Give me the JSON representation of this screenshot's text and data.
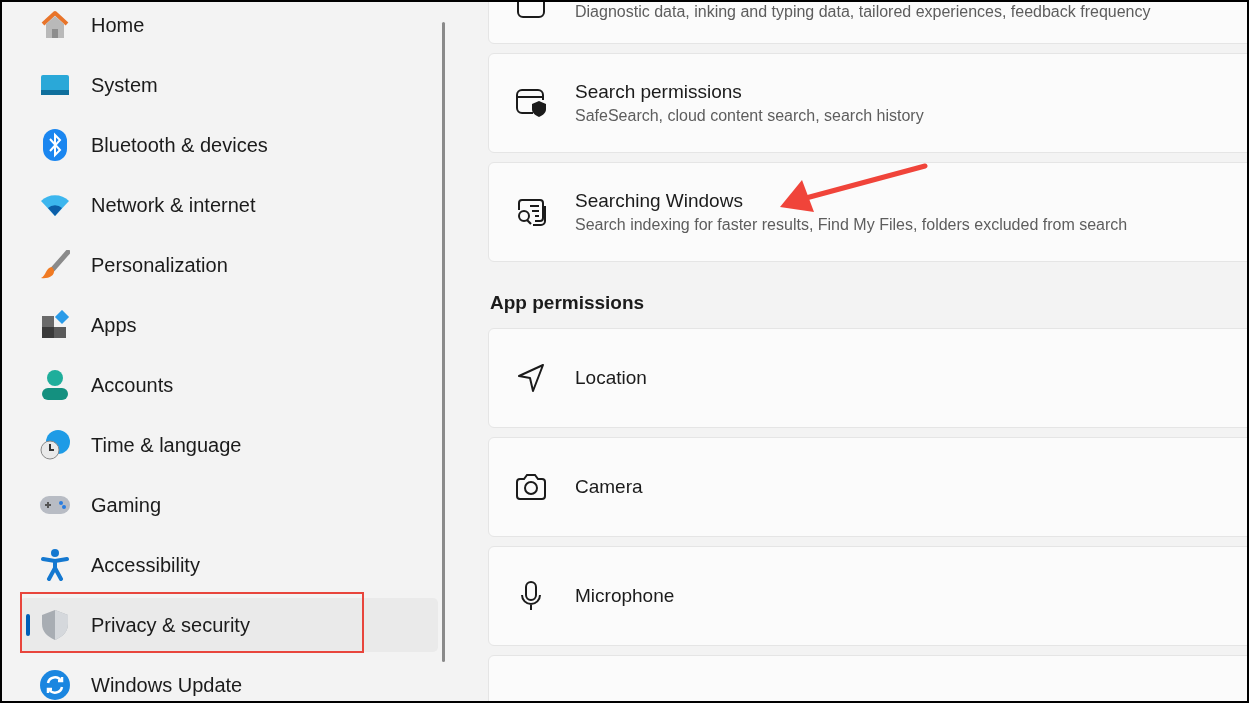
{
  "sidebar": {
    "items": [
      {
        "label": "Home",
        "selected": false
      },
      {
        "label": "System",
        "selected": false
      },
      {
        "label": "Bluetooth & devices",
        "selected": false
      },
      {
        "label": "Network & internet",
        "selected": false
      },
      {
        "label": "Personalization",
        "selected": false
      },
      {
        "label": "Apps",
        "selected": false
      },
      {
        "label": "Accounts",
        "selected": false
      },
      {
        "label": "Time & language",
        "selected": false
      },
      {
        "label": "Gaming",
        "selected": false
      },
      {
        "label": "Accessibility",
        "selected": false
      },
      {
        "label": "Privacy & security",
        "selected": true
      },
      {
        "label": "Windows Update",
        "selected": false
      }
    ]
  },
  "main": {
    "cards": [
      {
        "subtitle": "Diagnostic data, inking and typing data, tailored experiences, feedback frequency"
      },
      {
        "title": "Search permissions",
        "subtitle": "SafeSearch, cloud content search, search history"
      },
      {
        "title": "Searching Windows",
        "subtitle": "Search indexing for faster results, Find My Files, folders excluded from search"
      }
    ],
    "section": {
      "heading": "App permissions",
      "cards": [
        {
          "title": "Location"
        },
        {
          "title": "Camera"
        },
        {
          "title": "Microphone"
        }
      ]
    }
  }
}
